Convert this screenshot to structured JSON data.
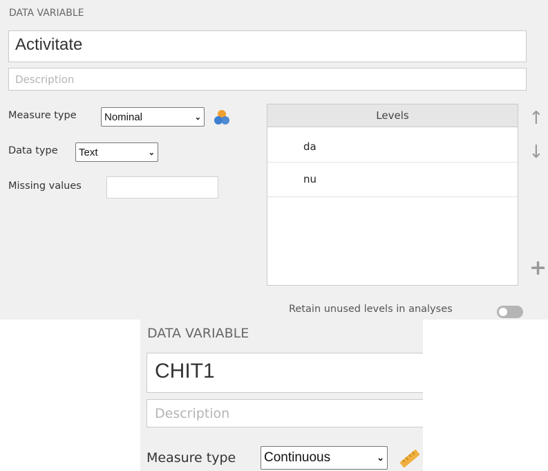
{
  "panel1": {
    "section_title": "DATA VARIABLE",
    "name_value": "Activitate",
    "description_placeholder": "Description",
    "measure_type_label": "Measure type",
    "measure_type_value": "Nominal",
    "measure_icon": "nominal-circles-icon",
    "data_type_label": "Data type",
    "data_type_value": "Text",
    "missing_values_label": "Missing values",
    "missing_values_value": "",
    "levels_header": "Levels",
    "levels": [
      "da",
      "nu"
    ],
    "move_up_icon": "arrow-up-icon",
    "move_down_icon": "arrow-down-icon",
    "add_icon": "plus-icon",
    "retain_label": "Retain unused levels in analyses",
    "retain_enabled": false
  },
  "panel2": {
    "section_title": "DATA VARIABLE",
    "name_value": "CHIT1",
    "description_placeholder": "Description",
    "measure_type_label": "Measure type",
    "measure_type_value": "Continuous",
    "measure_icon": "continuous-ruler-icon"
  },
  "colors": {
    "panel_bg": "#f0f0f0",
    "header_bg": "#e6e6e6",
    "nominal_orange": "#f0a030",
    "nominal_blue": "#3d7fd0",
    "ruler_orange": "#f0b040"
  }
}
